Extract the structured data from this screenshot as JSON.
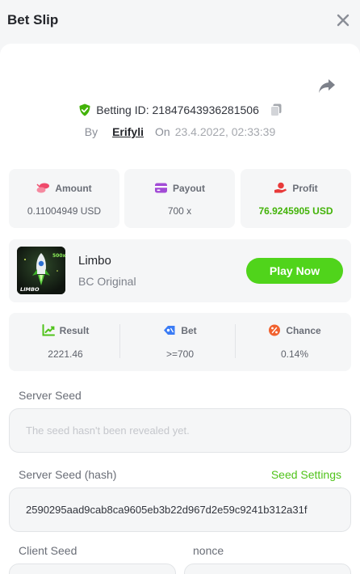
{
  "header": {
    "title": "Bet Slip",
    "close_icon": "close-icon"
  },
  "bet": {
    "betting_id_label": "Betting ID:",
    "betting_id": "21847643936281506",
    "by_label": "By",
    "user": "Erifyli",
    "on_label": "On",
    "datetime": "23.4.2022, 02:33:39"
  },
  "stats": {
    "amount": {
      "label": "Amount",
      "value": "0.11004949 USD",
      "icon": "coins-icon"
    },
    "payout": {
      "label": "Payout",
      "value": "700 x",
      "icon": "card-icon"
    },
    "profit": {
      "label": "Profit",
      "value": "76.9245905 USD",
      "icon": "hand-coin-icon",
      "color": "#43b309"
    }
  },
  "game": {
    "name": "Limbo",
    "provider": "BC Original",
    "play_label": "Play Now",
    "thumb_text": "LIMBO",
    "thumb_badge": "500x"
  },
  "result": {
    "result": {
      "label": "Result",
      "value": "2221.46"
    },
    "bet": {
      "label": "Bet",
      "value": ">=700"
    },
    "chance": {
      "label": "Chance",
      "value": "0.14%"
    }
  },
  "seeds": {
    "server_seed_label": "Server Seed",
    "server_seed_placeholder": "The seed hasn't been revealed yet.",
    "server_hash_label": "Server Seed (hash)",
    "seed_settings_label": "Seed Settings",
    "server_hash": "2590295aad9cab8ca9605eb3b22d967d2e59c9241b312a31f",
    "client_seed_label": "Client Seed",
    "nonce_label": "nonce"
  },
  "colors": {
    "accent": "#50d41b",
    "profit": "#43b309",
    "amount_icon": "#ef4a6b",
    "payout_icon": "#a24bd6",
    "result_icon": "#50c31b",
    "bet_icon": "#3b7cf5",
    "chance_icon": "#f1622f"
  }
}
